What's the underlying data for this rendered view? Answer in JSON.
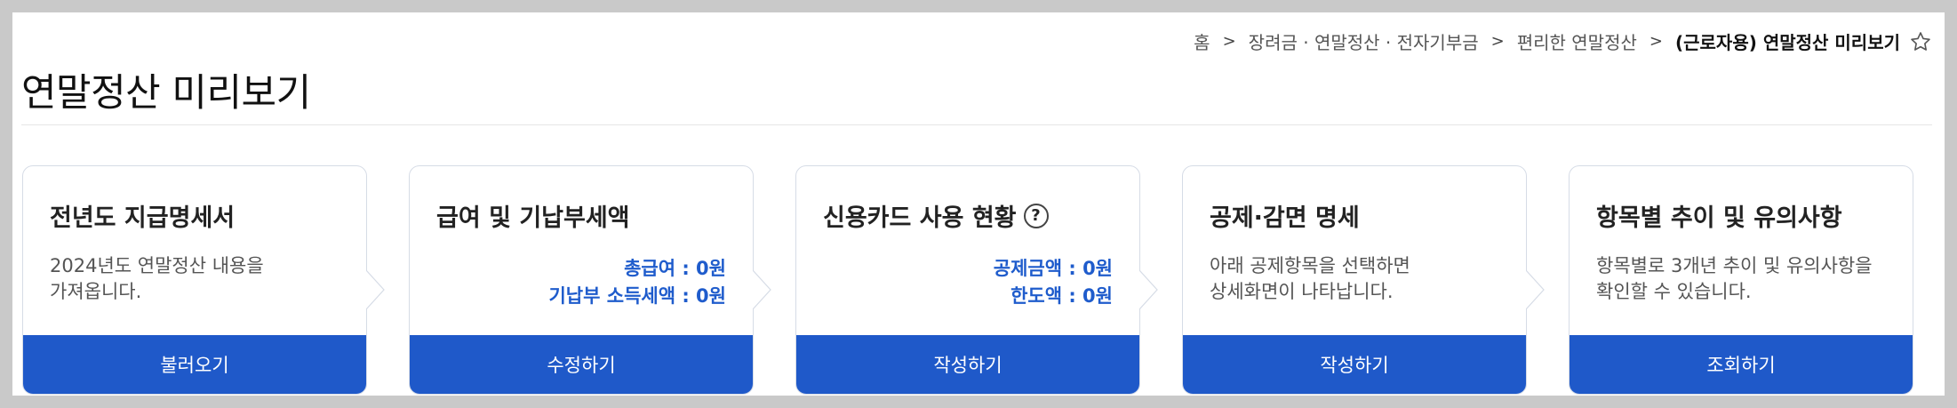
{
  "breadcrumb": {
    "items": [
      "홈",
      "장려금 · 연말정산 · 전자기부금",
      "편리한 연말정산"
    ],
    "current": "(근로자용) 연말정산 미리보기",
    "separator": ">"
  },
  "page": {
    "title": "연말정산 미리보기"
  },
  "cards": [
    {
      "title": "전년도 지급명세서",
      "desc_lines": [
        "2024년도 연말정산 내용을",
        "가져옵니다."
      ],
      "button": "불러오기"
    },
    {
      "title": "급여 및 기납부세액",
      "stats": [
        "총급여 : 0원",
        "기납부 소득세액 : 0원"
      ],
      "button": "수정하기"
    },
    {
      "title": "신용카드 사용 현황",
      "help": "?",
      "stats": [
        "공제금액 : 0원",
        "한도액 : 0원"
      ],
      "button": "작성하기"
    },
    {
      "title": "공제·감면 명세",
      "desc_lines": [
        "아래 공제항목을 선택하면",
        "상세화면이 나타납니다."
      ],
      "button": "작성하기"
    },
    {
      "title": "항목별 추이 및 유의사항",
      "desc_lines": [
        "항목별로 3개년 추이 및 유의사항을",
        "확인할 수 있습니다."
      ],
      "button": "조회하기"
    }
  ],
  "colors": {
    "primary": "#1f59c9",
    "stat_text": "#1f5ccc",
    "card_border": "#d6dce6"
  },
  "icons": {
    "favorite": "star-outline-icon",
    "help": "question-circle-icon"
  }
}
